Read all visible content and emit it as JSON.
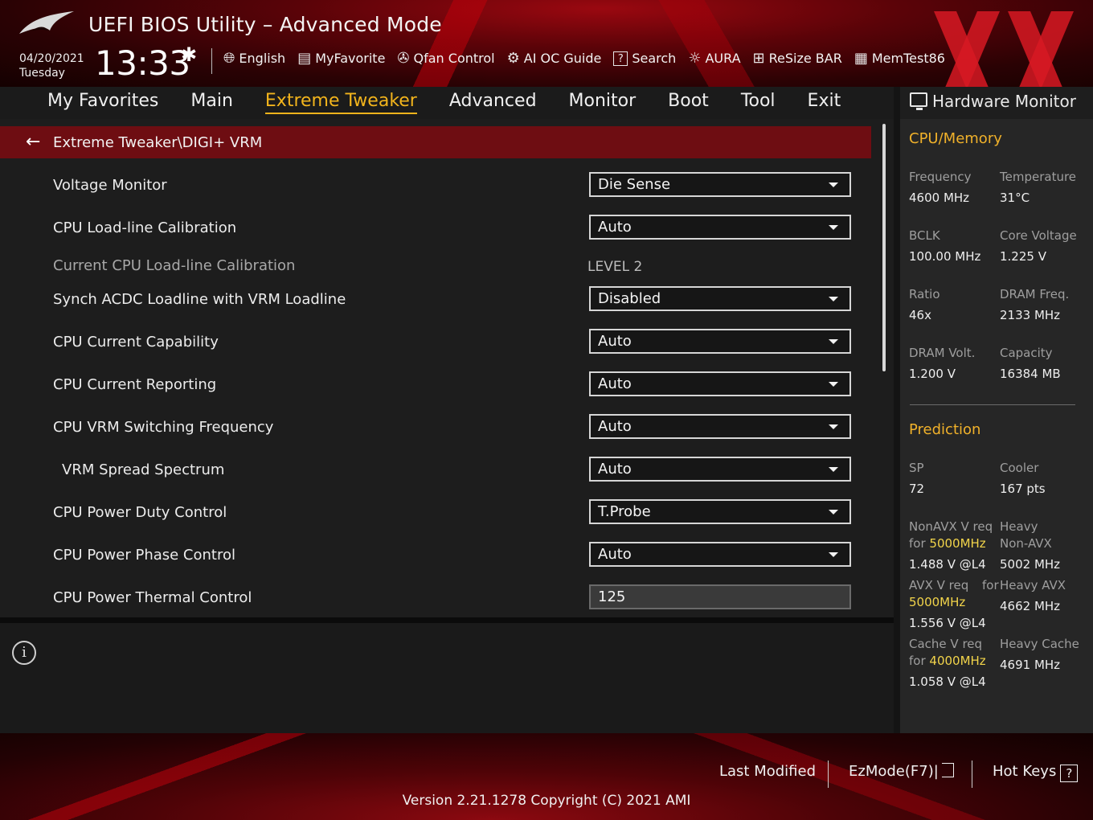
{
  "header": {
    "app_title": "UEFI BIOS Utility – Advanced Mode",
    "date": "04/20/2021",
    "weekday": "Tuesday",
    "time": "13:33",
    "toolbar": [
      {
        "label": "English",
        "icon": "globe-icon"
      },
      {
        "label": "MyFavorite",
        "icon": "favorite-list-icon"
      },
      {
        "label": "Qfan Control",
        "icon": "fan-icon"
      },
      {
        "label": "AI OC Guide",
        "icon": "chip-icon"
      },
      {
        "label": "Search",
        "icon": "question-box-icon"
      },
      {
        "label": "AURA",
        "icon": "aura-light-icon"
      },
      {
        "label": "ReSize BAR",
        "icon": "resize-bar-icon"
      },
      {
        "label": "MemTest86",
        "icon": "memory-icon"
      }
    ]
  },
  "nav": {
    "tabs": [
      "My Favorites",
      "Main",
      "Extreme Tweaker",
      "Advanced",
      "Monitor",
      "Boot",
      "Tool",
      "Exit"
    ],
    "active": "Extreme Tweaker"
  },
  "breadcrumb": "Extreme Tweaker\\DIGI+ VRM",
  "settings": [
    {
      "label": "Voltage Monitor",
      "type": "dropdown",
      "value": "Die Sense"
    },
    {
      "label": "CPU Load-line Calibration",
      "type": "dropdown",
      "value": "Auto"
    },
    {
      "label": "Current CPU Load-line Calibration",
      "type": "readonly",
      "value": "LEVEL 2"
    },
    {
      "label": "Synch ACDC Loadline with VRM Loadline",
      "type": "dropdown",
      "value": "Disabled"
    },
    {
      "label": "CPU Current Capability",
      "type": "dropdown",
      "value": "Auto"
    },
    {
      "label": "CPU Current Reporting",
      "type": "dropdown",
      "value": "Auto"
    },
    {
      "label": "CPU VRM Switching Frequency",
      "type": "dropdown",
      "value": "Auto"
    },
    {
      "label": "VRM Spread Spectrum",
      "type": "dropdown",
      "value": "Auto"
    },
    {
      "label": "CPU Power Duty Control",
      "type": "dropdown",
      "value": "T.Probe"
    },
    {
      "label": "CPU Power Phase Control",
      "type": "dropdown",
      "value": "Auto"
    },
    {
      "label": "CPU Power Thermal Control",
      "type": "input",
      "value": "125"
    }
  ],
  "hardware_monitor": {
    "title": "Hardware Monitor",
    "cpu_memory": {
      "heading": "CPU/Memory",
      "items": [
        {
          "label": "Frequency",
          "value": "4600 MHz"
        },
        {
          "label": "Temperature",
          "value": "31°C"
        },
        {
          "label": "BCLK",
          "value": "100.00 MHz"
        },
        {
          "label": "Core Voltage",
          "value": "1.225 V"
        },
        {
          "label": "Ratio",
          "value": "46x"
        },
        {
          "label": "DRAM Freq.",
          "value": "2133 MHz"
        },
        {
          "label": "DRAM Volt.",
          "value": "1.200 V"
        },
        {
          "label": "Capacity",
          "value": "16384 MB"
        }
      ]
    },
    "prediction": {
      "heading": "Prediction",
      "sp_label": "SP",
      "sp_value": "72",
      "cooler_label": "Cooler",
      "cooler_value": "167 pts",
      "nonavx_label_a": "NonAVX V req",
      "nonavx_label_b": "for",
      "nonavx_freq": "5000MHz",
      "nonavx_value": "1.488 V @L4",
      "heavy_nonavx_label_a": "Heavy",
      "heavy_nonavx_label_b": "Non-AVX",
      "heavy_nonavx_value": "5002 MHz",
      "avx_label_a": "AVX V req",
      "avx_label_b": "for",
      "avx_freq": "5000MHz",
      "avx_value": "1.556 V @L4",
      "heavy_avx_label": "Heavy AVX",
      "heavy_avx_value": "4662 MHz",
      "cache_label_a": "Cache V req",
      "cache_label_b": "for",
      "cache_freq": "4000MHz",
      "cache_value": "1.058 V @L4",
      "heavy_cache_label": "Heavy Cache",
      "heavy_cache_value": "4691 MHz"
    }
  },
  "footer": {
    "last_modified": "Last Modified",
    "ezmode": "EzMode(F7)|",
    "hot_keys": "Hot Keys",
    "hot_keys_icon": "?",
    "version": "Version 2.21.1278 Copyright (C) 2021 AMI"
  },
  "colors": {
    "accent": "#f2b41c",
    "highlight": "#f2d44a",
    "breadcrumb_bg": "#6e0d12",
    "brand_red": "#9a0810"
  }
}
